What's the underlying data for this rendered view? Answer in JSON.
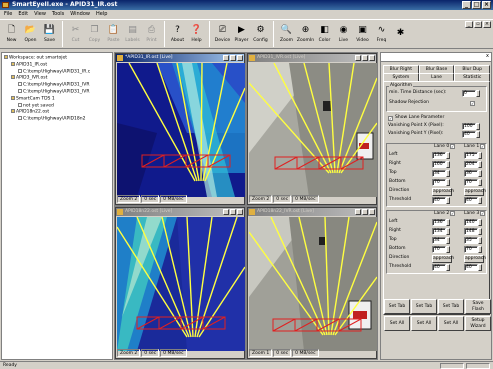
{
  "window": {
    "title": "SmartEyeII.exe - APID31_IR.ost"
  },
  "menu": [
    "File",
    "Edit",
    "View",
    "Tools",
    "Window",
    "Help"
  ],
  "toolbar": [
    {
      "label": "New",
      "icon": "new-file-icon",
      "glyph": "🗋",
      "enabled": true
    },
    {
      "label": "Open",
      "icon": "open-folder-icon",
      "glyph": "📂",
      "enabled": true
    },
    {
      "label": "Save",
      "icon": "save-icon",
      "glyph": "💾",
      "enabled": true
    },
    {
      "label": "Cut",
      "icon": "cut-icon",
      "glyph": "✂",
      "enabled": false
    },
    {
      "label": "Copy",
      "icon": "copy-icon",
      "glyph": "❐",
      "enabled": false
    },
    {
      "label": "Paste",
      "icon": "paste-icon",
      "glyph": "📋",
      "enabled": false
    },
    {
      "label": "Labels",
      "icon": "labels-icon",
      "glyph": "▤",
      "enabled": false
    },
    {
      "label": "Print",
      "icon": "print-icon",
      "glyph": "⎙",
      "enabled": false
    },
    {
      "label": "About",
      "icon": "about-icon",
      "glyph": "?",
      "enabled": true
    },
    {
      "label": "Help",
      "icon": "help-icon",
      "glyph": "❓",
      "enabled": true
    },
    {
      "label": "Device",
      "icon": "device-icon",
      "glyph": "⎚",
      "enabled": true
    },
    {
      "label": "Player",
      "icon": "player-icon",
      "glyph": "▶",
      "enabled": true
    },
    {
      "label": "Config",
      "icon": "config-icon",
      "glyph": "⚙",
      "enabled": true
    },
    {
      "label": "Zoom",
      "icon": "zoom-icon",
      "glyph": "🔍",
      "enabled": true
    },
    {
      "label": "ZoomIn",
      "icon": "zoom-in-icon",
      "glyph": "⊕",
      "enabled": true
    },
    {
      "label": "Color",
      "icon": "color-icon",
      "glyph": "◧",
      "enabled": true
    },
    {
      "label": "Live",
      "icon": "live-icon",
      "glyph": "◉",
      "enabled": true
    },
    {
      "label": "Video",
      "icon": "video-icon",
      "glyph": "▣",
      "enabled": true
    },
    {
      "label": "Freq",
      "icon": "frequency-icon",
      "glyph": "∿",
      "enabled": true
    },
    {
      "label": "",
      "icon": "extra-icon",
      "glyph": "✱",
      "enabled": true
    }
  ],
  "tree": [
    {
      "text": "Workspace: out smartojet",
      "indent": 0
    },
    {
      "text": "APID31_IR.ost",
      "indent": 1
    },
    {
      "text": "C:\\temp\\Highway\\APID31_IR.c",
      "indent": 2
    },
    {
      "text": "APID3_IVR.ost",
      "indent": 1
    },
    {
      "text": "C:\\temp\\Highway\\APID31_IVR",
      "indent": 2
    },
    {
      "text": "C:\\temp\\Highway\\APID31_IVR",
      "indent": 2
    },
    {
      "text": "SmartCam TDS 1",
      "indent": 1
    },
    {
      "text": "not yet saved",
      "indent": 2
    },
    {
      "text": "APID18n22.ost",
      "indent": 1
    },
    {
      "text": "C:\\temp\\Highway\\APID18n2",
      "indent": 2
    }
  ],
  "views": [
    {
      "title": "*APID31_IR.ost [Live]",
      "status": [
        "Zoom 2",
        "0 sec",
        "0 MB/sec"
      ]
    },
    {
      "title": "APID31_IVR.ost [Live]",
      "status": [
        "Zoom 2",
        "0 sec",
        "0 MB/sec"
      ]
    },
    {
      "title": "APID18n22.ost [Live]",
      "status": [
        "Zoom 2",
        "0 sec",
        "0 MB/sec"
      ]
    },
    {
      "title": "APID18n22_IVR.ost [Live]",
      "status": [
        "Zoom 1",
        "0 sec",
        "0 MB/sec"
      ]
    }
  ],
  "panel": {
    "close": "x",
    "tabs_row1": [
      "Blur Right",
      "Blur Base",
      "Blur Dup"
    ],
    "tabs_row2": [
      "System",
      "Lane",
      "Statistic"
    ],
    "algorithm_label": "Algorithm",
    "min_time_label": "min. Time Distance (sec):",
    "min_time_value": "0",
    "shadow_label": "Shadow Rejection",
    "show_lane_label": "Show Lane Parameter",
    "vp_x_label": "Vanishing Point X (Pixel):",
    "vp_x_value": "100",
    "vp_y_label": "Vanishing Point Y (Pixel):",
    "vp_y_value": "40",
    "lane_hdr_1": "Lane 0",
    "lane_hdr_2": "Lane 1",
    "lane_hdr_3": "Lane 2",
    "lane_hdr_4": "Lane 3",
    "rows": [
      "Left",
      "Right",
      "Top",
      "Bottom",
      "Direction",
      "Threshold"
    ],
    "lanes_a": [
      [
        "136",
        "175"
      ],
      [
        "160",
        "204"
      ],
      [
        "34",
        "36"
      ],
      [
        "70",
        "70"
      ],
      [
        "approach",
        "approach"
      ],
      [
        "40",
        "40"
      ]
    ],
    "lanes_b": [
      [
        "136",
        "140"
      ],
      [
        "134",
        "148"
      ],
      [
        "34",
        "35"
      ],
      [
        "70",
        "70"
      ],
      [
        "approach",
        "approach"
      ],
      [
        "40",
        "40"
      ]
    ],
    "buttons": [
      "Set Tab",
      "Set Tab",
      "Set Tab",
      "Save Flash",
      "Set All",
      "Set All",
      "Set All",
      "Setup Wizard"
    ]
  },
  "statusbar": {
    "text": "Ready"
  }
}
